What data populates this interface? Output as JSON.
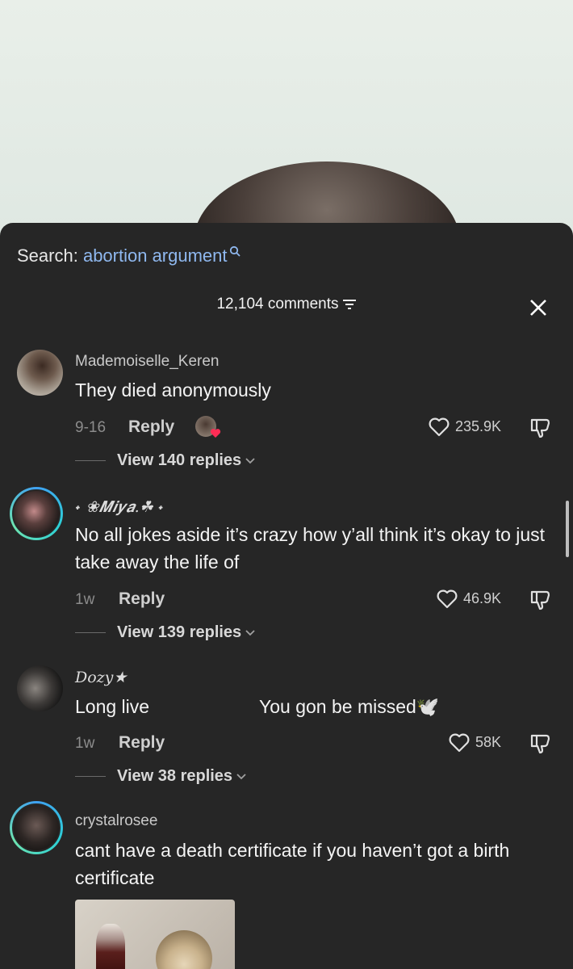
{
  "search": {
    "prefix": "Search:",
    "query": "abortion argument"
  },
  "header": {
    "count_label": "12,104 comments"
  },
  "comments": [
    {
      "username": "Mademoiselle_Keren",
      "text": "They died anonymously",
      "date": "9-16",
      "reply_label": "Reply",
      "likes": "235.9K",
      "view_replies": "View 140 replies"
    },
    {
      "username": "˖ ❀𝑴𝒊𝒚𝒂.☘︎ ˖",
      "text": "No all jokes aside it’s crazy how y’all think it’s okay to just take away the life of",
      "date": "1w",
      "reply_label": "Reply",
      "likes": "46.9K",
      "view_replies": "View 139 replies"
    },
    {
      "username": "𝐷𝑜𝑧𝑦★",
      "text_left": "Long live",
      "text_right": "You gon be missed🕊️",
      "date": "1w",
      "reply_label": "Reply",
      "likes": "58K",
      "view_replies": "View 38 replies"
    },
    {
      "username": "crystalrosee",
      "text": "cant have a death certificate if you haven’t got a birth certificate"
    }
  ],
  "colors": {
    "panel": "#262626",
    "accent_query": "#8fb8ef",
    "ring_start": "#3fa1f2",
    "ring_end": "#6ee3b0"
  },
  "icons": [
    "search-icon",
    "filter-icon",
    "close-icon",
    "heart-icon",
    "dislike-icon",
    "chevron-down-icon"
  ]
}
